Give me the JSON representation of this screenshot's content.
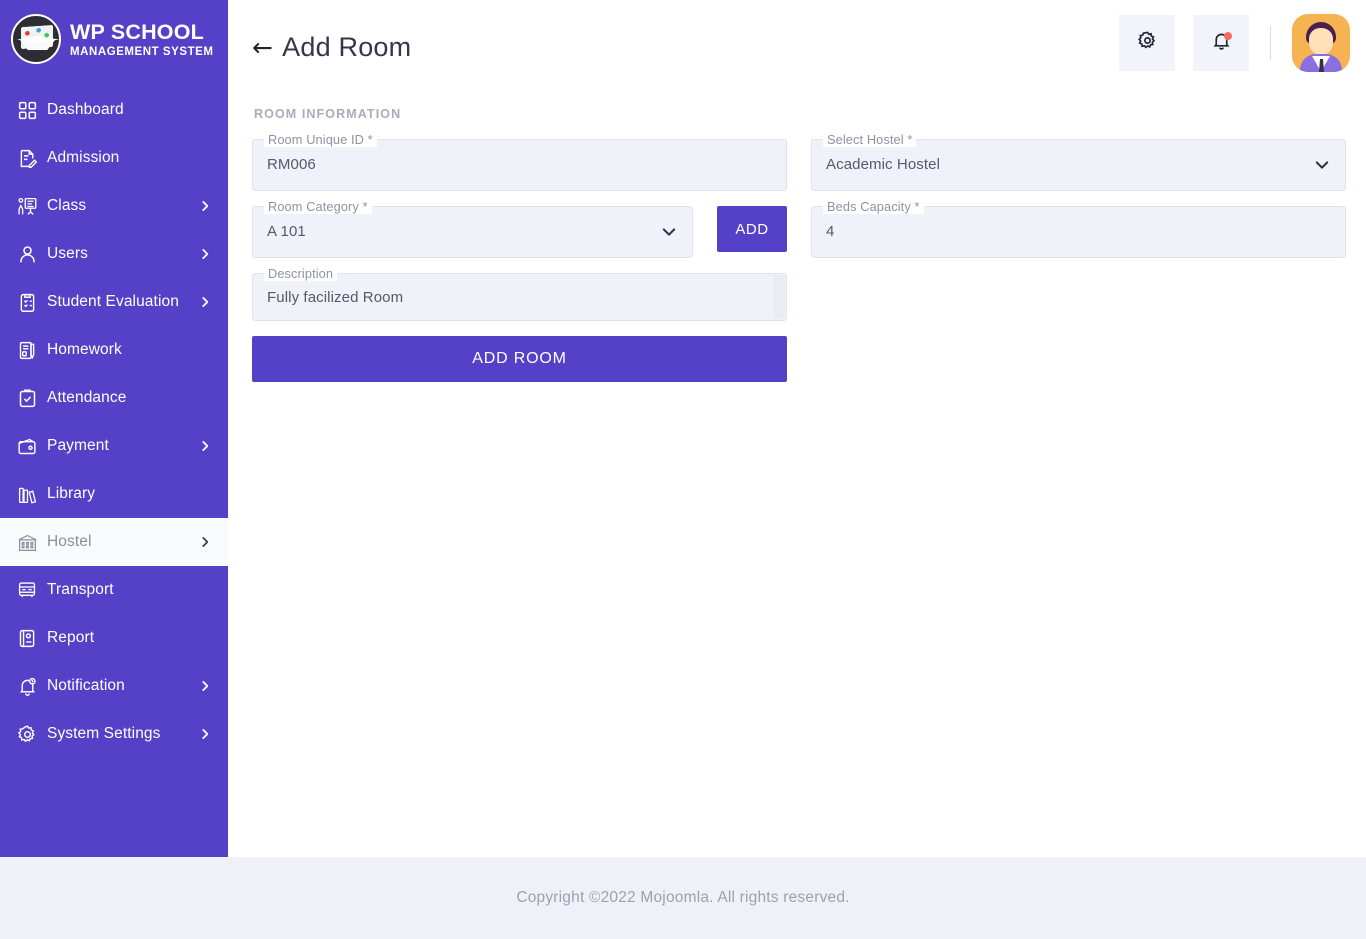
{
  "brand": {
    "title": "WP SCHOOL",
    "subtitle": "MANAGEMENT SYSTEM",
    "logo_icon": "graduation-cap-icon"
  },
  "colors": {
    "sidebar_bg": "#5541c8",
    "primary": "#5541c8",
    "field_bg": "#eff2f8",
    "footer_bg": "#eef2f8",
    "active_item_bg": "#f9fbfd",
    "badge": "#fd6a5e",
    "avatar_bg": "#f6b352"
  },
  "sidebar": {
    "items": [
      {
        "label": "Dashboard",
        "icon": "grid-icon",
        "has_children": false,
        "active": false
      },
      {
        "label": "Admission",
        "icon": "document-pen-icon",
        "has_children": false,
        "active": false
      },
      {
        "label": "Class",
        "icon": "classroom-icon",
        "has_children": true,
        "active": false
      },
      {
        "label": "Users",
        "icon": "user-icon",
        "has_children": true,
        "active": false
      },
      {
        "label": "Student Evaluation",
        "icon": "clipboard-check-icon",
        "has_children": true,
        "active": false
      },
      {
        "label": "Homework",
        "icon": "notebook-pen-icon",
        "has_children": false,
        "active": false
      },
      {
        "label": "Attendance",
        "icon": "clipboard-tick-icon",
        "has_children": false,
        "active": false
      },
      {
        "label": "Payment",
        "icon": "wallet-icon",
        "has_children": true,
        "active": false
      },
      {
        "label": "Library",
        "icon": "books-icon",
        "has_children": false,
        "active": false
      },
      {
        "label": "Hostel",
        "icon": "building-icon",
        "has_children": true,
        "active": true
      },
      {
        "label": "Transport",
        "icon": "bus-icon",
        "has_children": false,
        "active": false
      },
      {
        "label": "Report",
        "icon": "report-icon",
        "has_children": false,
        "active": false
      },
      {
        "label": "Notification",
        "icon": "bell-icon",
        "has_children": true,
        "active": false
      },
      {
        "label": "System Settings",
        "icon": "gear-icon",
        "has_children": true,
        "active": false
      }
    ]
  },
  "header": {
    "back_arrow": "←",
    "title": "Add Room",
    "settings_icon": "gear-icon",
    "notifications_icon": "bell-icon",
    "avatar_icon": "user-avatar"
  },
  "main": {
    "section_title": "ROOM INFORMATION",
    "fields": {
      "room_unique_id": {
        "label": "Room Unique ID *",
        "value": "RM006"
      },
      "select_hostel": {
        "label": "Select Hostel *",
        "value": "Academic Hostel",
        "type": "select"
      },
      "room_category": {
        "label": "Room Category *",
        "value": "A 101",
        "type": "select"
      },
      "beds_capacity": {
        "label": "Beds Capacity *",
        "value": "4"
      },
      "description": {
        "label": "Description",
        "value": "Fully facilized Room",
        "type": "textarea"
      }
    },
    "buttons": {
      "add": "ADD",
      "add_room": "ADD ROOM"
    }
  },
  "footer": {
    "text": "Copyright ©2022 Mojoomla. All rights reserved."
  }
}
